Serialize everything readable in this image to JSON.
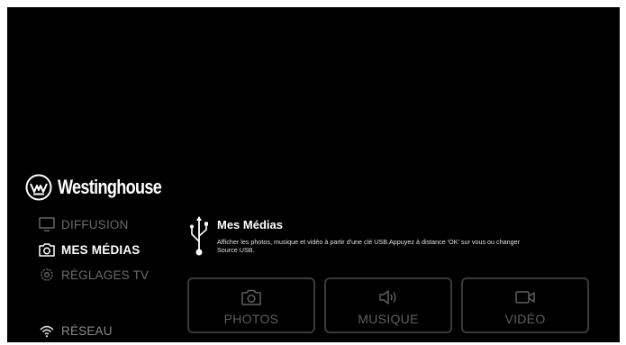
{
  "brand": {
    "name": "Westinghouse"
  },
  "menu": {
    "items": [
      {
        "label": "DIFFUSION",
        "icon": "monitor-icon",
        "state": "inactive"
      },
      {
        "label": "MES MÉDIAS",
        "icon": "camera-icon",
        "state": "selected"
      },
      {
        "label": "RÉGLAGES TV",
        "icon": "gear-icon",
        "state": "inactive"
      },
      {
        "label": "RÉSEAU",
        "icon": "wifi-icon",
        "state": "inactive"
      }
    ]
  },
  "panel": {
    "title": "Mes Médias",
    "icon": "usb-icon",
    "description": "Afficher les photos, musique et vidéo à partir d'une clé USB.Appuyez à distance 'OK' sur vous ou changer Source USB."
  },
  "tiles": [
    {
      "label": "PHOTOS",
      "icon": "camera-icon"
    },
    {
      "label": "MUSIQUE",
      "icon": "speaker-icon"
    },
    {
      "label": "VIDÉO",
      "icon": "video-camera-icon"
    }
  ],
  "colors": {
    "background": "#000000",
    "text_active": "#ffffff",
    "text_inactive": "#6b6b6b",
    "tile_border": "#3a3a3a"
  }
}
